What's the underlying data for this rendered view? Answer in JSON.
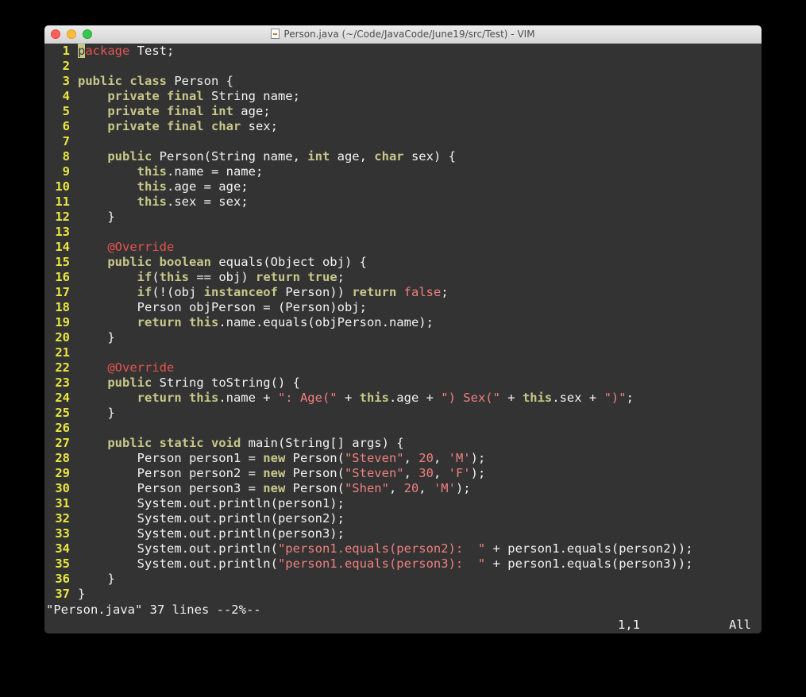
{
  "window": {
    "title": "Person.java (~/Code/JavaCode/June19/src/Test) - VIM"
  },
  "colors": {
    "background": "#333333",
    "line_number": "#e8e840",
    "keyword": "#c8c88a",
    "string": "#f0807f",
    "annotation": "#e5554f",
    "text": "#f2f2f2"
  },
  "lines": [
    [
      [
        "package",
        "cursorkw"
      ],
      [
        " Test;",
        ""
      ]
    ],
    [],
    [
      [
        "public class",
        "kw"
      ],
      [
        " Person {",
        ""
      ]
    ],
    [
      [
        "    ",
        ""
      ],
      [
        "private final",
        "kw"
      ],
      [
        " String name;",
        ""
      ]
    ],
    [
      [
        "    ",
        ""
      ],
      [
        "private final int",
        "kw"
      ],
      [
        " age;",
        ""
      ]
    ],
    [
      [
        "    ",
        ""
      ],
      [
        "private final char",
        "kw"
      ],
      [
        " sex;",
        ""
      ]
    ],
    [],
    [
      [
        "    ",
        ""
      ],
      [
        "public",
        "kw"
      ],
      [
        " Person(String name, ",
        ""
      ],
      [
        "int",
        "kw"
      ],
      [
        " age, ",
        ""
      ],
      [
        "char",
        "kw"
      ],
      [
        " sex) {",
        ""
      ]
    ],
    [
      [
        "        ",
        ""
      ],
      [
        "this",
        "kw"
      ],
      [
        ".name = name;",
        ""
      ]
    ],
    [
      [
        "        ",
        ""
      ],
      [
        "this",
        "kw"
      ],
      [
        ".age = age;",
        ""
      ]
    ],
    [
      [
        "        ",
        ""
      ],
      [
        "this",
        "kw"
      ],
      [
        ".sex = sex;",
        ""
      ]
    ],
    [
      [
        "    }",
        ""
      ]
    ],
    [],
    [
      [
        "    ",
        ""
      ],
      [
        "@Override",
        "ann"
      ]
    ],
    [
      [
        "    ",
        ""
      ],
      [
        "public boolean",
        "kw"
      ],
      [
        " equals(Object obj) {",
        ""
      ]
    ],
    [
      [
        "        ",
        ""
      ],
      [
        "if",
        "kw"
      ],
      [
        "(",
        ""
      ],
      [
        "this",
        "kw"
      ],
      [
        " == obj) ",
        ""
      ],
      [
        "return",
        "kw"
      ],
      [
        " ",
        ""
      ],
      [
        "true",
        "kw"
      ],
      [
        ";",
        ""
      ]
    ],
    [
      [
        "        ",
        ""
      ],
      [
        "if",
        "kw"
      ],
      [
        "(!(obj ",
        ""
      ],
      [
        "instanceof",
        "kw"
      ],
      [
        " Person)) ",
        ""
      ],
      [
        "return",
        "kw"
      ],
      [
        " ",
        ""
      ],
      [
        "false",
        "str"
      ],
      [
        ";",
        ""
      ]
    ],
    [
      [
        "        Person objPerson = (Person)obj;",
        ""
      ]
    ],
    [
      [
        "        ",
        ""
      ],
      [
        "return this",
        "kw"
      ],
      [
        ".name.equals(objPerson.name);",
        ""
      ]
    ],
    [
      [
        "    }",
        ""
      ]
    ],
    [],
    [
      [
        "    ",
        ""
      ],
      [
        "@Override",
        "ann"
      ]
    ],
    [
      [
        "    ",
        ""
      ],
      [
        "public",
        "kw"
      ],
      [
        " String toString() {",
        ""
      ]
    ],
    [
      [
        "        ",
        ""
      ],
      [
        "return this",
        "kw"
      ],
      [
        ".name + ",
        ""
      ],
      [
        "\": Age(\"",
        "str"
      ],
      [
        " + ",
        ""
      ],
      [
        "this",
        "kw"
      ],
      [
        ".age + ",
        ""
      ],
      [
        "\") Sex(\"",
        "str"
      ],
      [
        " + ",
        ""
      ],
      [
        "this",
        "kw"
      ],
      [
        ".sex + ",
        ""
      ],
      [
        "\")\"",
        "str"
      ],
      [
        ";",
        ""
      ]
    ],
    [
      [
        "    }",
        ""
      ]
    ],
    [],
    [
      [
        "    ",
        ""
      ],
      [
        "public static void",
        "kw"
      ],
      [
        " main(String[] args) {",
        ""
      ]
    ],
    [
      [
        "        Person person1 = ",
        ""
      ],
      [
        "new",
        "kw"
      ],
      [
        " Person(",
        ""
      ],
      [
        "\"Steven\"",
        "str"
      ],
      [
        ", ",
        ""
      ],
      [
        "20",
        "str"
      ],
      [
        ", ",
        ""
      ],
      [
        "'M'",
        "str"
      ],
      [
        ");",
        ""
      ]
    ],
    [
      [
        "        Person person2 = ",
        ""
      ],
      [
        "new",
        "kw"
      ],
      [
        " Person(",
        ""
      ],
      [
        "\"Steven\"",
        "str"
      ],
      [
        ", ",
        ""
      ],
      [
        "30",
        "str"
      ],
      [
        ", ",
        ""
      ],
      [
        "'F'",
        "str"
      ],
      [
        ");",
        ""
      ]
    ],
    [
      [
        "        Person person3 = ",
        ""
      ],
      [
        "new",
        "kw"
      ],
      [
        " Person(",
        ""
      ],
      [
        "\"Shen\"",
        "str"
      ],
      [
        ", ",
        ""
      ],
      [
        "20",
        "str"
      ],
      [
        ", ",
        ""
      ],
      [
        "'M'",
        "str"
      ],
      [
        ");",
        ""
      ]
    ],
    [
      [
        "        System.out.println(person1);",
        ""
      ]
    ],
    [
      [
        "        System.out.println(person2);",
        ""
      ]
    ],
    [
      [
        "        System.out.println(person3);",
        ""
      ]
    ],
    [
      [
        "        System.out.println(",
        ""
      ],
      [
        "\"person1.equals(person2):  \"",
        "str"
      ],
      [
        " + person1.equals(person2));",
        ""
      ]
    ],
    [
      [
        "        System.out.println(",
        ""
      ],
      [
        "\"person1.equals(person3):  \"",
        "str"
      ],
      [
        " + person1.equals(person3));",
        ""
      ]
    ],
    [
      [
        "    }",
        ""
      ]
    ],
    [
      [
        "}",
        ""
      ]
    ]
  ],
  "status": {
    "message": "\"Person.java\" 37 lines --2%--",
    "ruler": "1,1",
    "scope": "All"
  }
}
